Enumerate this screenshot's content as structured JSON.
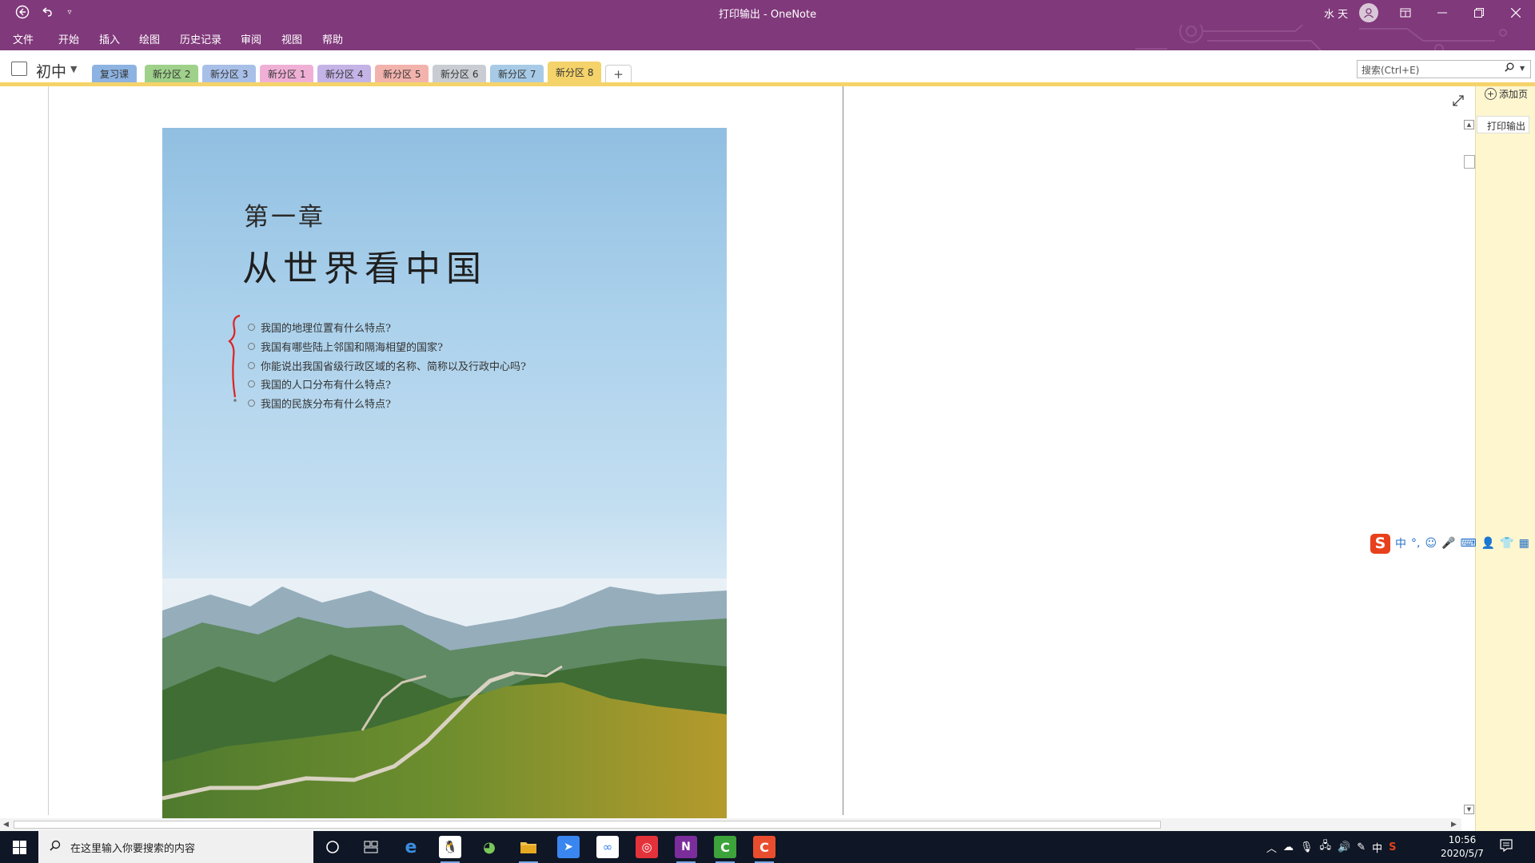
{
  "window": {
    "title": "打印输出  -  OneNote",
    "user_name": "水 天",
    "accent_color": "#80397b"
  },
  "menu": [
    "文件",
    "开始",
    "插入",
    "绘图",
    "历史记录",
    "审阅",
    "视图",
    "帮助"
  ],
  "notebook": {
    "name": "初中",
    "tabs": [
      {
        "label": "复习课",
        "color": "#8db3e2"
      },
      {
        "label": "新分区 2",
        "color": "#9fd18b"
      },
      {
        "label": "新分区 3",
        "color": "#a8c0e8"
      },
      {
        "label": "新分区 1",
        "color": "#f0b0d6"
      },
      {
        "label": "新分区 4",
        "color": "#c4b3e6"
      },
      {
        "label": "新分区 5",
        "color": "#f3b3ad"
      },
      {
        "label": "新分区 6",
        "color": "#c9cdd3"
      },
      {
        "label": "新分区 7",
        "color": "#a7cbe6"
      },
      {
        "label": "新分区 8",
        "color": "#f5d36b",
        "active": true
      }
    ],
    "add_tab": "+"
  },
  "search": {
    "placeholder": "搜索(Ctrl+E)"
  },
  "printout": {
    "chapter": "第一章",
    "title": "从世界看中国",
    "questions": [
      "我国的地理位置有什么特点?",
      "我国有哪些陆上邻国和隔海相望的国家?",
      "你能说出我国省级行政区域的名称、简称以及行政中心吗?",
      "我国的人口分布有什么特点?",
      "我国的民族分布有什么特点?"
    ]
  },
  "page_panel": {
    "add_page": "添加页",
    "pages": [
      "打印输出"
    ]
  },
  "ime": {
    "items": [
      "中",
      "°,",
      "☺",
      "🎤",
      "⌨",
      "👤",
      "👕",
      "▦"
    ]
  },
  "taskbar": {
    "search_placeholder": "在这里输入你要搜索的内容",
    "apps": [
      "cortana",
      "task-view",
      "edge",
      "qq",
      "wechat",
      "file-explorer",
      "feishu",
      "baidu-netdisk",
      "netease-music",
      "onenote",
      "camtasia",
      "screen-recorder"
    ],
    "clock_time": "10:56",
    "clock_date": "2020/5/7",
    "ime_indicator": "中"
  }
}
